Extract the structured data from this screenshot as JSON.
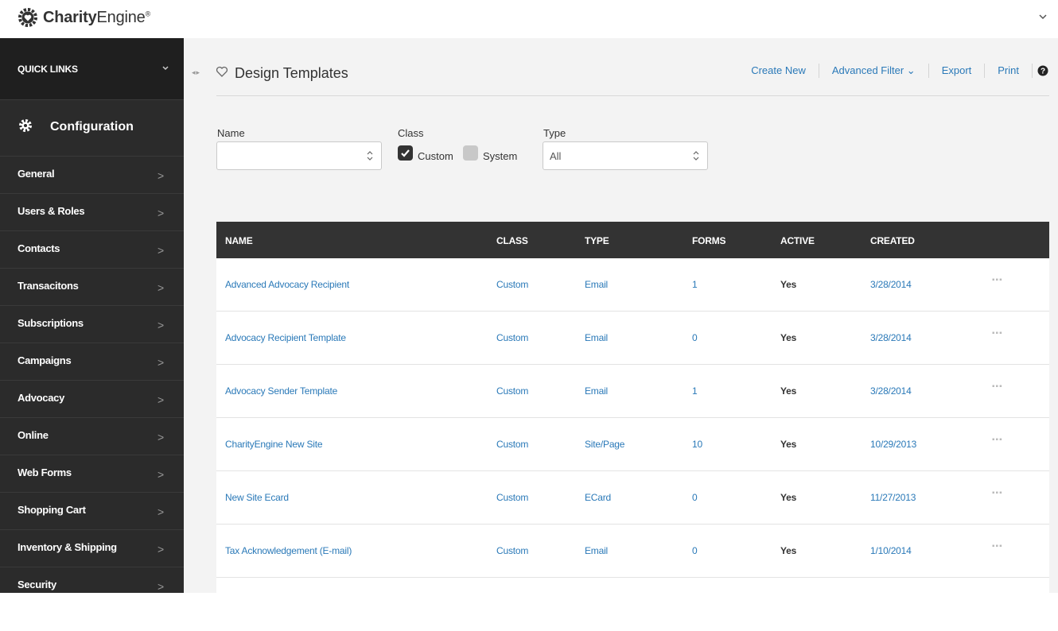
{
  "brand": {
    "name_prefix": "Charity",
    "name_suffix": "Engine",
    "mark": "®"
  },
  "sidebar": {
    "quick_links_label": "QUICK LINKS",
    "section_title": "Configuration",
    "items": [
      {
        "label": "General"
      },
      {
        "label": "Users & Roles"
      },
      {
        "label": "Contacts"
      },
      {
        "label": "Transacitons"
      },
      {
        "label": "Subscriptions"
      },
      {
        "label": "Campaigns"
      },
      {
        "label": "Advocacy"
      },
      {
        "label": "Online"
      },
      {
        "label": "Web Forms"
      },
      {
        "label": "Shopping Cart"
      },
      {
        "label": "Inventory & Shipping"
      },
      {
        "label": "Security"
      }
    ],
    "arrow": ">"
  },
  "header": {
    "handle": "◂▸",
    "title": "Design Templates",
    "actions": {
      "create_new": "Create New",
      "advanced_filter": "Advanced Filter ⌄",
      "export": "Export",
      "print": "Print"
    }
  },
  "filters": {
    "name_label": "Name",
    "name_value": "",
    "class_label": "Class",
    "class_custom_label": "Custom",
    "class_custom_checked": true,
    "class_system_label": "System",
    "class_system_checked": false,
    "type_label": "Type",
    "type_value": "All"
  },
  "table": {
    "columns": [
      "NAME",
      "CLASS",
      "TYPE",
      "FORMS",
      "ACTIVE",
      "CREATED"
    ],
    "rows": [
      {
        "name": "Advanced Advocacy Recipient",
        "class": "Custom",
        "type": "Email",
        "forms": "1",
        "active": "Yes",
        "created": "3/28/2014"
      },
      {
        "name": "Advocacy Recipient Template",
        "class": "Custom",
        "type": "Email",
        "forms": "0",
        "active": "Yes",
        "created": "3/28/2014"
      },
      {
        "name": "Advocacy Sender Template",
        "class": "Custom",
        "type": "Email",
        "forms": "1",
        "active": "Yes",
        "created": "3/28/2014"
      },
      {
        "name": "CharityEngine New Site",
        "class": "Custom",
        "type": "Site/Page",
        "forms": "10",
        "active": "Yes",
        "created": "10/29/2013"
      },
      {
        "name": "New Site Ecard",
        "class": "Custom",
        "type": "ECard",
        "forms": "0",
        "active": "Yes",
        "created": "11/27/2013"
      },
      {
        "name": "Tax Acknowledgement (E-mail)",
        "class": "Custom",
        "type": "Email",
        "forms": "0",
        "active": "Yes",
        "created": "1/10/2014"
      }
    ],
    "row_menu": "▪▪▪"
  },
  "colors": {
    "link": "#2a79b8",
    "sidebar_bg": "#2b2b2b",
    "table_header_bg": "#333333"
  }
}
